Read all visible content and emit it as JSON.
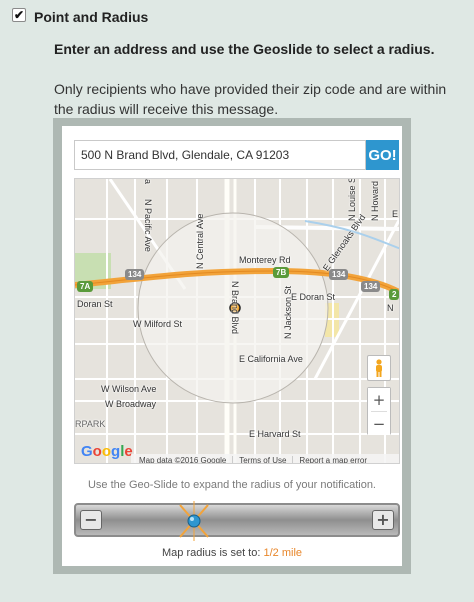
{
  "section": {
    "title": "Point and Radius",
    "checked": true
  },
  "instructions": {
    "bold": "Enter an address and use the Geoslide to select a radius.",
    "normal": "Only recipients who have provided their zip code and are within the radius will receive this message."
  },
  "address": {
    "value": "500 N Brand Blvd, Glendale, CA 91203",
    "go_label": "GO!"
  },
  "map": {
    "labels": {
      "pacific": "N Pacific Ave",
      "central": "N Central Ave",
      "brand": "N Brand Blvd",
      "jackson": "N Jackson St",
      "louise": "N Louise St",
      "howard": "N Howard St",
      "glenoaks": "E Glenoaks Blvd",
      "monterey": "Monterey Rd",
      "doran_w": "Doran St",
      "doran_e": "E Doran St",
      "milford": "W Milford St",
      "california": "E California Ave",
      "wilson": "W Wilson Ave",
      "broadway": "W Broadway",
      "harvard": "E Harvard St",
      "park": "RPARK",
      "e_partial": "E",
      "n_partial": "N",
      "a_partial": "a"
    },
    "shields": [
      "134",
      "7A",
      "7B",
      "134",
      "134",
      "2"
    ],
    "google": "Google",
    "map_data": "Map data ©2016 Google",
    "terms": "Terms of Use",
    "report": "Report a map error",
    "zoom_in": "+",
    "zoom_out": "−"
  },
  "geoslide": {
    "hint": "Use the Geo-Slide to expand the radius of your notification.",
    "minus_label": "−",
    "plus_label": "+",
    "level": 0.38
  },
  "radius": {
    "label": "Map radius is set to:",
    "value": "1/2 mile"
  },
  "colors": {
    "go": "#2e96cf",
    "highway": "#f2a33a",
    "radius_value": "#e8862a",
    "circle_fill": "#f4f2ee",
    "marker": "#f0a020"
  }
}
